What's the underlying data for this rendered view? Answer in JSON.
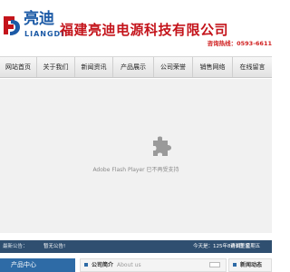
{
  "header": {
    "logo_cn": "亮迪",
    "logo_en": "LIANGDI",
    "company_name": "福建亮迪电源科技有限公司",
    "hotline": "咨询热线：0593-6611"
  },
  "nav": {
    "items": [
      {
        "label": "网站首页"
      },
      {
        "label": "关于我们"
      },
      {
        "label": "新闻资讯"
      },
      {
        "label": "产品展示"
      },
      {
        "label": "公司荣誉"
      },
      {
        "label": "销售网络"
      },
      {
        "label": "在线留言"
      }
    ]
  },
  "banner": {
    "plugin_message": "Adobe Flash Player 已不再受支持"
  },
  "notice": {
    "latest_label": "最新公告：",
    "message": "暂无公告!",
    "date": "今天是：125年8月8日 星期五",
    "login": "请调整您"
  },
  "panels": {
    "products_title": "产品中心",
    "about_title": "公司简介",
    "about_en": "About us",
    "news_title": "新闻动态"
  },
  "colors": {
    "brand_blue": "#1c5aa6",
    "company_red": "#c4141b",
    "notice_bg": "#2f4f70"
  }
}
